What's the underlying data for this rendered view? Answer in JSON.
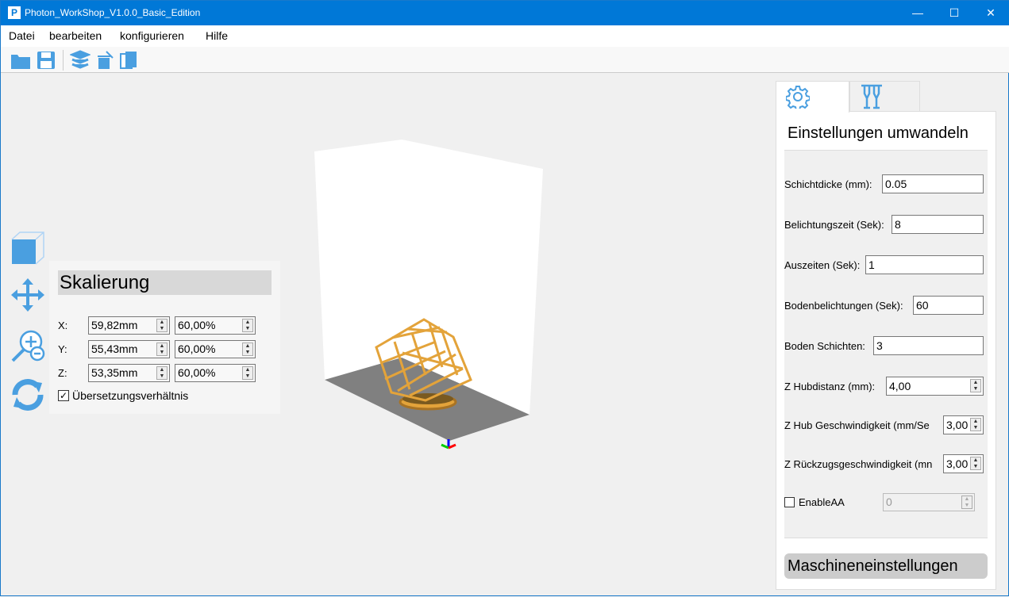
{
  "window": {
    "title": "Photon_WorkShop_V1.0.0_Basic_Edition",
    "logo": "P",
    "minimize": "—",
    "maximize": "☐",
    "close": "✕"
  },
  "menu": [
    "Datei",
    "bearbeiten",
    "konfigurieren",
    "Hilfe"
  ],
  "toolbar": [
    "open-folder-icon",
    "save-icon",
    "slice-layers-icon",
    "delete-icon",
    "copy-icon"
  ],
  "scale": {
    "title": "Skalierung",
    "rows": [
      {
        "axis": "X:",
        "mm": "59,82mm",
        "pct": "60,00%"
      },
      {
        "axis": "Y:",
        "mm": "55,43mm",
        "pct": "60,00%"
      },
      {
        "axis": "Z:",
        "mm": "53,35mm",
        "pct": "60,00%"
      }
    ],
    "lock_label": "Übersetzungsverhältnis",
    "lock_checked": true
  },
  "settings": {
    "title": "Einstellungen umwandeln",
    "fields": [
      {
        "label": "Schichtdicke (mm):",
        "value": "0.05"
      },
      {
        "label": "Belichtungszeit (Sek):",
        "value": "8"
      },
      {
        "label": "Auszeiten (Sek):",
        "value": "1"
      },
      {
        "label": "Bodenbelichtungen (Sek):",
        "value": "60"
      },
      {
        "label": "Boden Schichten:",
        "value": "3"
      },
      {
        "label": "Z Hubdistanz (mm):",
        "value": "4,00"
      },
      {
        "label": "Z Hub Geschwindigkeit (mm/Se",
        "value": "3,00"
      },
      {
        "label": "Z Rückzugsgeschwindigkeit (mn",
        "value": "3,00"
      }
    ],
    "aa_label": "EnableAA",
    "aa_value": "0",
    "aa_checked": false,
    "machine_button": "Maschineneinstellungen"
  },
  "colors": {
    "accent": "#0078d7",
    "icon": "#4a9fe0",
    "model": "#e3a33a",
    "plate": "#808080"
  }
}
